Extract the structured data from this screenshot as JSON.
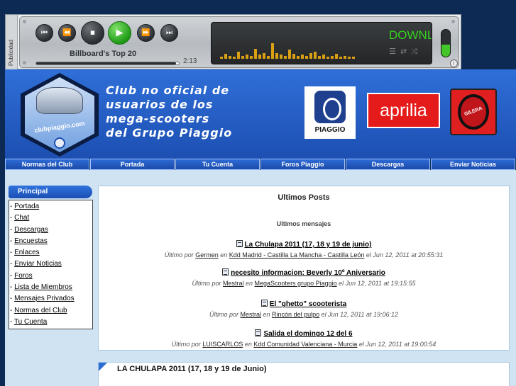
{
  "ad": {
    "label": "Publicidad"
  },
  "player": {
    "buttons": [
      {
        "name": "previous-button",
        "icon": "skip-back-icon",
        "glyph": "⏮"
      },
      {
        "name": "rewind-button",
        "icon": "rewind-icon",
        "glyph": "⏪"
      },
      {
        "name": "stop-button",
        "icon": "stop-icon",
        "glyph": "⏹"
      },
      {
        "name": "play-button",
        "icon": "play-icon",
        "glyph": "▶"
      },
      {
        "name": "forward-button",
        "icon": "fast-forward-icon",
        "glyph": "⏩"
      },
      {
        "name": "next-button",
        "icon": "skip-next-icon",
        "glyph": "⏭"
      }
    ],
    "track_title": "Billboard's Top 20",
    "time": "2:13",
    "progress": 0.98,
    "screen_text": "DOWNL",
    "volume_level": 0.45,
    "colors": {
      "screen_text": "#34d21b",
      "equalizer": "#d9a013",
      "play": "#1f9a16"
    },
    "equalizer_levels": [
      0.1,
      0.25,
      0.15,
      0.1,
      0.35,
      0.15,
      0.2,
      0.15,
      0.5,
      0.2,
      0.3,
      0.15,
      0.8,
      0.3,
      0.2,
      0.15,
      0.45,
      0.25,
      0.15,
      0.2,
      0.15,
      0.3,
      0.35,
      0.15,
      0.2,
      0.1,
      0.15,
      0.25,
      0.1,
      0.15,
      0.1,
      0.12
    ]
  },
  "banner": {
    "slogan": [
      "Club no oficial de",
      "usuarios de los",
      "mega-scooters",
      "del Grupo Piaggio"
    ],
    "logo_text": "clubpiaggio.com",
    "brands": {
      "piaggio": "PIAGGIO",
      "aprilia": "aprilia",
      "gilera": "GILERA"
    }
  },
  "nav": [
    "Normas del Club",
    "Portada",
    "Tu Cuenta",
    "Foros Piaggio",
    "Descargas",
    "Enviar Noticias"
  ],
  "sidebar": {
    "title": "Principal",
    "links": [
      "Portada",
      "Chat",
      "Descargas",
      "Encuestas",
      "Enlaces",
      "Enviar Noticias",
      "Foros",
      "Lista de Miembros",
      "Mensajes Privados",
      "Normas del Club",
      "Tu Cuenta"
    ]
  },
  "posts": {
    "title": "Ultimos Posts",
    "subtitle": "Ultimos mensajes",
    "items": [
      {
        "title": "La Chulapa 2011 (17, 18 y 19 de junio)",
        "prefix": "Último por",
        "author": "Germen",
        "in": "en",
        "forum": "Kdd Madrid - Castilla La Mancha - Castilla León",
        "date": "el Jun 12, 2011 at 20:55:31"
      },
      {
        "title": "necesito informacion: Beverly 10º Aniversario",
        "prefix": "Último por",
        "author": "Mestral",
        "in": "en",
        "forum": "MegaScooters grupo Piaggio",
        "date": "el Jun 12, 2011 at 19:15:55"
      },
      {
        "title": "El \"ghetto\" scooterista",
        "prefix": "Último por",
        "author": "Mestral",
        "in": "en",
        "forum": "Rincón del pulpo",
        "date": "el Jun 12, 2011 at 19:06:12"
      },
      {
        "title": "Salida el domingo 12 del 6",
        "prefix": "Último por",
        "author": "LUISCARLOS",
        "in": "en",
        "forum": "Kdd Comunidad Valenciana - Murcia",
        "date": "el Jun 12, 2011 at 19:00:54"
      }
    ]
  },
  "article": {
    "title": "LA CHULAPA 2011 (17, 18 y 19 de Junio)"
  }
}
